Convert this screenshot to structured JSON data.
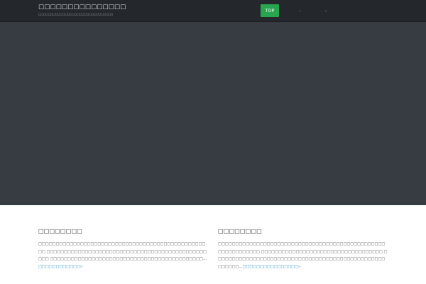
{
  "header": {
    "site_title": "□□□□□□□□□□□□□□□",
    "site_description": "□□□□□□□□□□□□□□□□□□□□□□□□□□□□□□□"
  },
  "nav": {
    "items": [
      {
        "label": "TOP",
        "active": true
      },
      {
        "label": "-"
      },
      {
        "label": "-"
      }
    ],
    "active_color": "#27a64f"
  },
  "colors": {
    "header_bg": "#24282c",
    "hero_bg": "#373c43",
    "link": "#1a8dbf"
  },
  "posts": [
    {
      "title": "□□□□□□□□",
      "body": "□□□□□□□□□□□□□□□□□□□□□□□□□□□□□□□□□□□□□□□□□□□□□□□□□□ □□□□□□□□□□□□□□□□□□□□□□□□□□□□□□□□□□□□□□□□□□□□□□□□□ □□□□□□□□□□□□□□□□□□□□□□□□□□□□□□□□□□□□□□□□□□□□…",
      "read_more": "□□□□□□□□□□□□»"
    },
    {
      "title": "□□□□□□□□",
      "body": "□□□□□□□□□□□□□□□□□□□□□□□□□□□□□□□□□□□□□□□□□□□□□□□□□□□□□□□□□□□□ □□□□□□□□□□□□□□□□□□□□□□□□□□□□□□□□□□□ □□□□□□□□□□□□□□□□□□□□□□□□□□□□□□□□□□□□□□□□□□□□□□□□□□□□□□□…",
      "read_more": "□□□□□□□□□□□□□□□□»"
    }
  ]
}
